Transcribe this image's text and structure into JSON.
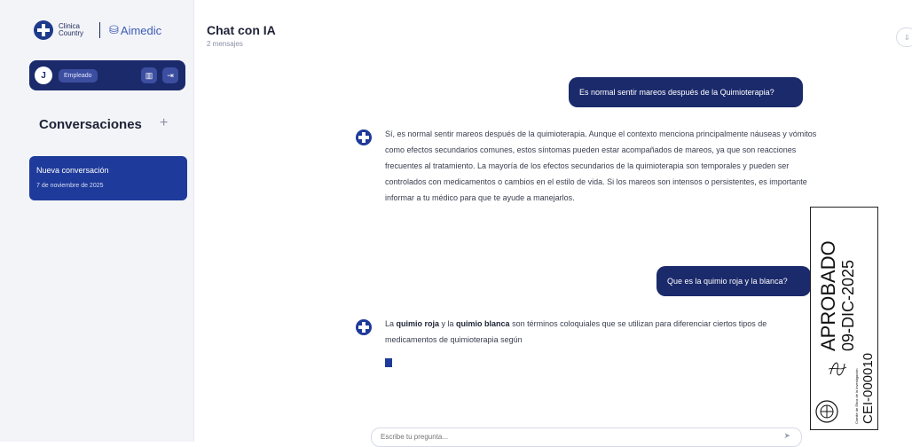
{
  "sidebar": {
    "brand": {
      "clinic_name": "Clinica Country",
      "partner": "Aimedic"
    },
    "user": {
      "initial": "J",
      "role": "Empleado"
    },
    "conversations_title": "Conversaciones",
    "add_label": "+",
    "items": [
      {
        "name": "Nueva conversación",
        "date": "7 de noviembre de 2025"
      }
    ]
  },
  "header": {
    "title": "Chat con IA",
    "subtitle": "2 mensajes",
    "right_button": "⇩"
  },
  "messages": [
    {
      "role": "user",
      "text": "Es normal sentir mareos después de la Quimioterapia?"
    },
    {
      "role": "assistant",
      "text": "Sí, es normal sentir mareos después de la quimioterapia. Aunque el contexto menciona principalmente náuseas y vómitos como efectos secundarios comunes, estos síntomas pueden estar acompañados de mareos, ya que son reacciones frecuentes al tratamiento. La mayoría de los efectos secundarios de la quimioterapia son temporales y pueden ser controlados con medicamentos o cambios en el estilo de vida. Si los mareos son intensos o persistentes, es importante informar a tu médico para que te ayude a manejarlos."
    },
    {
      "role": "user",
      "text": "Que es la quimio roja y la blanca?"
    },
    {
      "role": "assistant",
      "parts": [
        "La ",
        "quimio roja",
        " y la ",
        "quimio blanca",
        " son términos coloquiales que se utilizan para diferenciar ciertos tipos de medicamentos de quimioterapia según"
      ]
    }
  ],
  "input": {
    "placeholder": "Escribe tu pregunta..."
  },
  "stamp": {
    "status": "APROBADO",
    "date": "09-DIC-2025",
    "code": "CEI-000010",
    "committee": "Comité de Ética de la Investigación"
  },
  "colors": {
    "primary": "#1b2a6b",
    "accent": "#1e3a9a",
    "sidebar_bg": "#f3f4f8"
  }
}
